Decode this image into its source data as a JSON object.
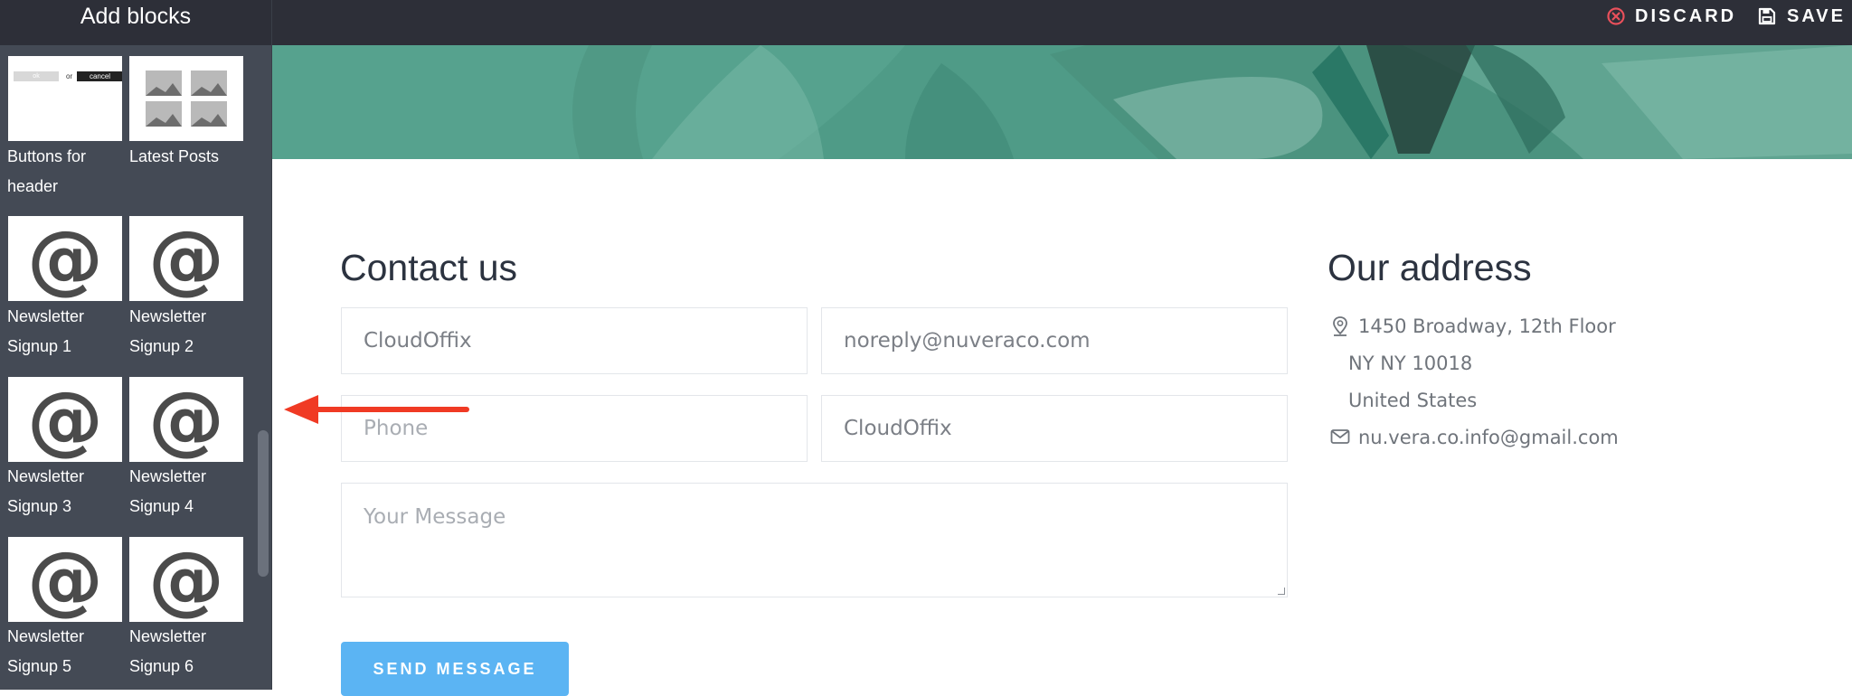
{
  "sidebar": {
    "title": "Add blocks",
    "blocks": [
      {
        "label_line1": "Buttons for",
        "label_line2": "header",
        "preview": "buttons",
        "ok_text": "ok",
        "or_text": "or",
        "cancel_text": "cancel"
      },
      {
        "label_line1": "Latest Posts",
        "label_line2": "",
        "preview": "posts"
      },
      {
        "label_line1": "Newsletter",
        "label_line2": "Signup 1",
        "preview": "at-icon"
      },
      {
        "label_line1": "Newsletter",
        "label_line2": "Signup 2",
        "preview": "at-icon"
      },
      {
        "label_line1": "Newsletter",
        "label_line2": "Signup 3",
        "preview": "at-icon"
      },
      {
        "label_line1": "Newsletter",
        "label_line2": "Signup 4",
        "preview": "at-icon"
      },
      {
        "label_line1": "Newsletter",
        "label_line2": "Signup 5",
        "preview": "at-icon"
      },
      {
        "label_line1": "Newsletter",
        "label_line2": "Signup 6",
        "preview": "at-icon"
      }
    ],
    "at_symbol": "@"
  },
  "toolbar": {
    "discard_label": "DISCARD",
    "save_label": "SAVE",
    "discard_icon": "close-circle-icon",
    "save_icon": "floppy-disk-icon"
  },
  "contact": {
    "heading": "Contact us",
    "name_value": "CloudOffix",
    "email_value": "noreply@nuveraco.com",
    "phone_placeholder": "Phone",
    "company_value": "CloudOffix",
    "message_placeholder": "Your Message",
    "send_label": "SEND MESSAGE"
  },
  "address": {
    "heading": "Our address",
    "street": "1450 Broadway, 12th Floor",
    "city": "NY NY 10018",
    "country": "United States",
    "email": "nu.vera.co.info@gmail.com",
    "location_icon": "map-pin-icon",
    "email_icon": "envelope-icon"
  },
  "colors": {
    "sidebar_bg": "#444a55",
    "topbar_bg": "#2d2f38",
    "discard_accent": "#e8505b",
    "hero_teal": "#4e9a86",
    "send_button": "#5bb4f3",
    "annotation_arrow": "#f03a24"
  }
}
